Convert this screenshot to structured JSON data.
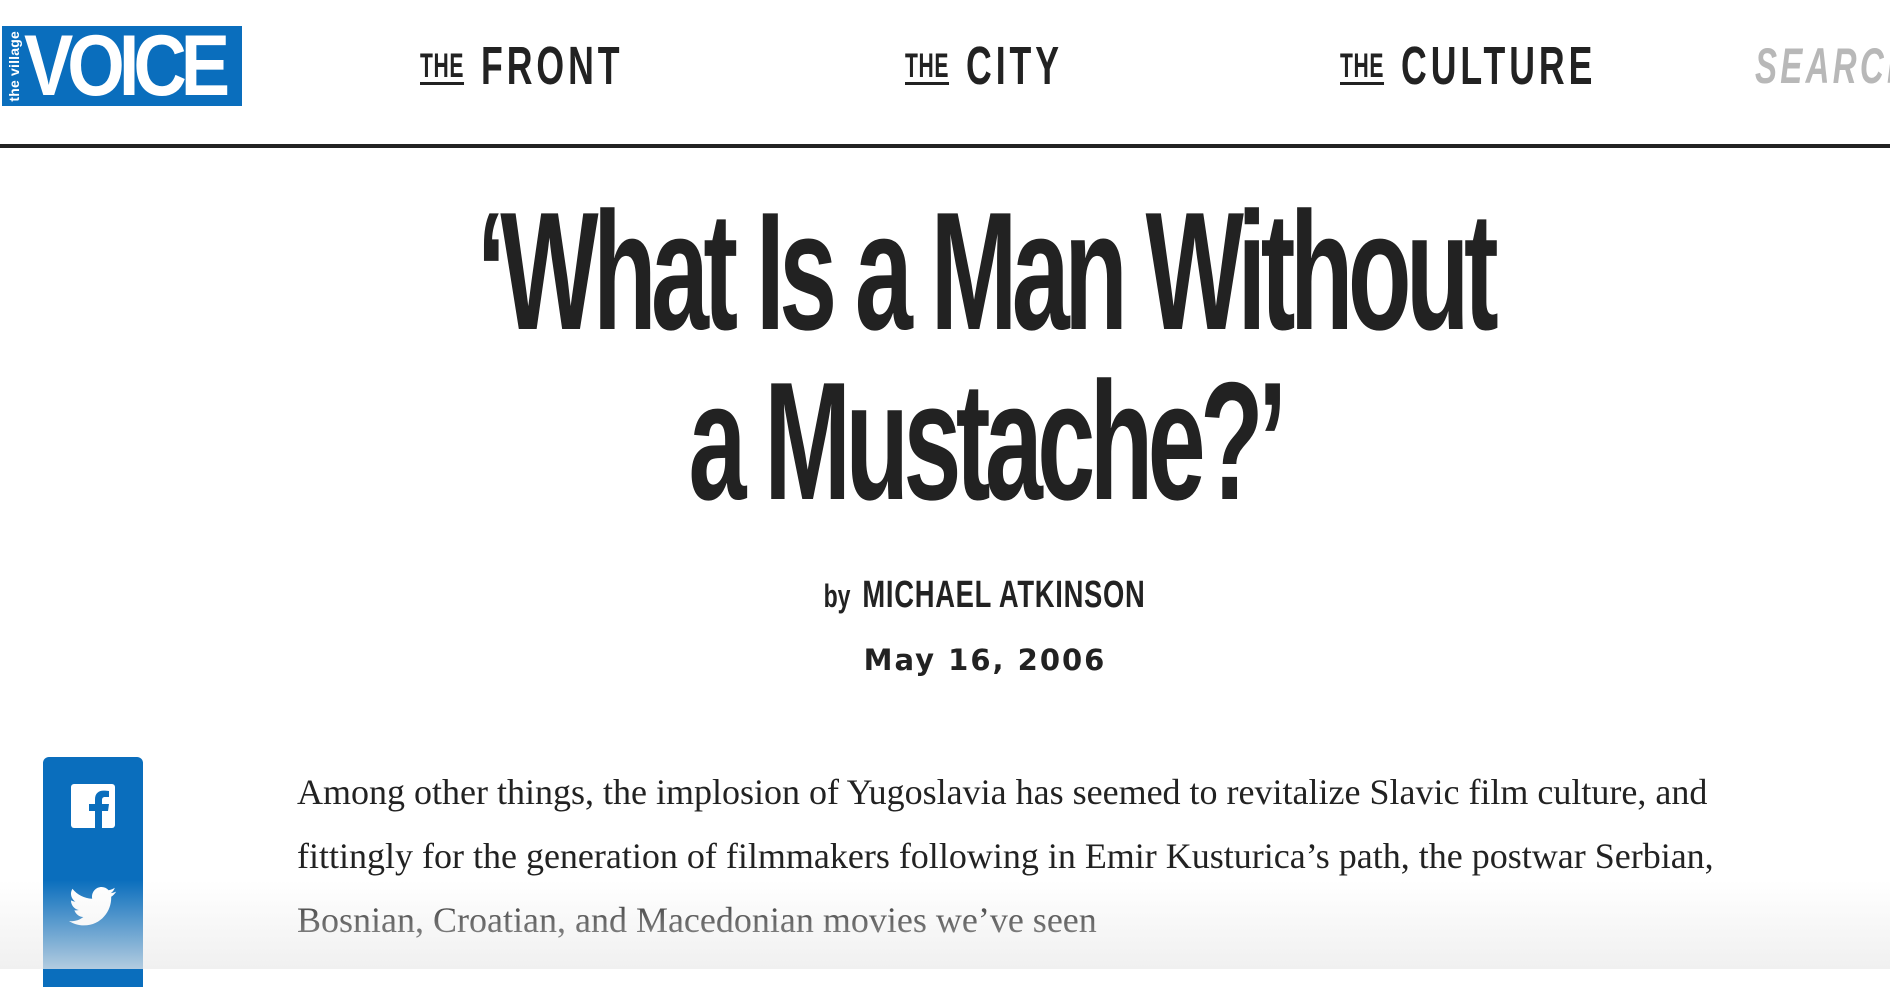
{
  "header": {
    "logo": {
      "small_text": "the village",
      "big_text": "VOICE"
    },
    "nav": [
      {
        "the": "THE",
        "word": "FRONT"
      },
      {
        "the": "THE",
        "word": "CITY"
      },
      {
        "the": "THE",
        "word": "CULTURE"
      }
    ],
    "search_label": "SEARCH"
  },
  "article": {
    "title": "‘What Is a Man Without a Mustache?’",
    "byline_prefix": "by",
    "author": "MICHAEL ATKINSON",
    "date": "May 16, 2006",
    "body": "Among other things, the implosion of Yugoslavia has seemed to revitalize Slavic film culture, and fittingly for the generation of filmmakers following in Emir Kusturica’s path, the postwar Serbian, Bosnian, Croatian, and Macedonian movies we’ve seen"
  },
  "share": {
    "buttons": [
      {
        "icon": "facebook-icon"
      },
      {
        "icon": "twitter-icon"
      }
    ]
  },
  "colors": {
    "brand_blue": "#0a6ebd",
    "text": "#222222",
    "search_gray": "#b8b8b8"
  }
}
